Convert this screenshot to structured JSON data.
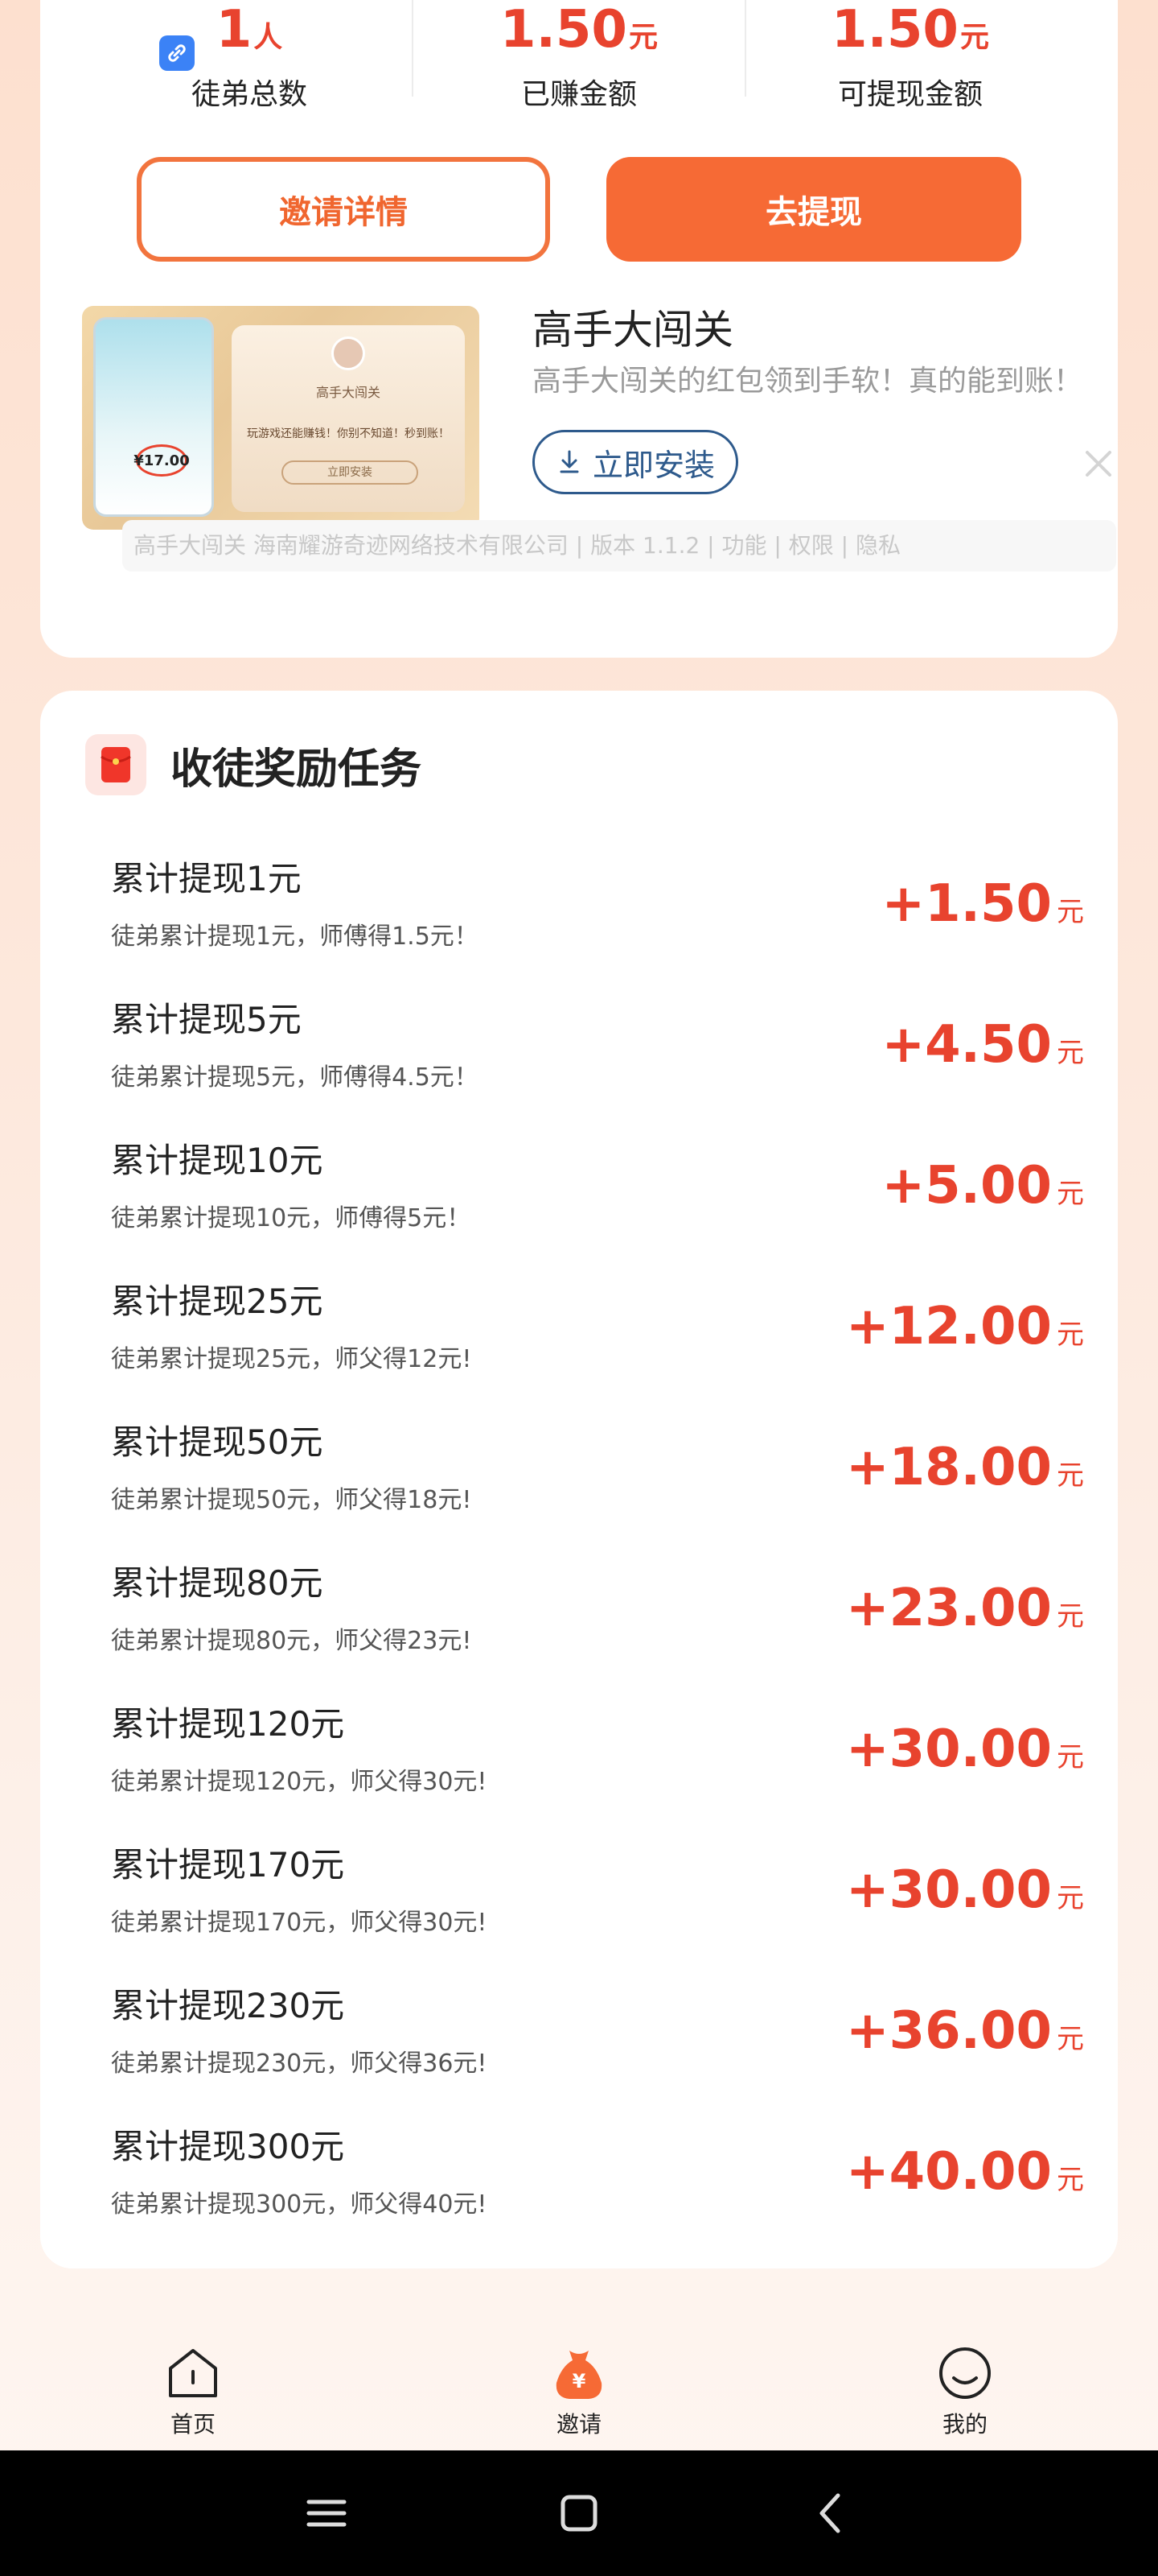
{
  "stats": [
    {
      "value": "1",
      "unit": "人",
      "label": "徒弟总数"
    },
    {
      "value": "1.50",
      "unit": "元",
      "label": "已赚金额"
    },
    {
      "value": "1.50",
      "unit": "元",
      "label": "可提现金额"
    }
  ],
  "buttons": {
    "invite_details": "邀请详情",
    "withdraw": "去提现"
  },
  "ad": {
    "image_title": "高手大闯关",
    "image_text1": "玩游戏还能赚钱！你别不知道！秒到账！",
    "image_amount": "¥17.00",
    "image_button": "立即安装",
    "title": "高手大闯关",
    "description": "高手大闯关的红包领到手软！真的能到账！",
    "install_label": "立即安装",
    "meta": "高手大闯关 海南耀游奇迹网络技术有限公司 | 版本 1.1.2 | 功能 | 权限 | 隐私"
  },
  "tasks_section": {
    "title": "收徒奖励任务",
    "items": [
      {
        "name": "累计提现1元",
        "desc": "徒弟累计提现1元，师傅得1.5元！",
        "reward": "+1.50",
        "unit": "元"
      },
      {
        "name": "累计提现5元",
        "desc": "徒弟累计提现5元，师傅得4.5元！",
        "reward": "+4.50",
        "unit": "元"
      },
      {
        "name": "累计提现10元",
        "desc": "徒弟累计提现10元，师傅得5元！",
        "reward": "+5.00",
        "unit": "元"
      },
      {
        "name": "累计提现25元",
        "desc": "徒弟累计提现25元，师父得12元!",
        "reward": "+12.00",
        "unit": "元"
      },
      {
        "name": "累计提现50元",
        "desc": "徒弟累计提现50元，师父得18元!",
        "reward": "+18.00",
        "unit": "元"
      },
      {
        "name": "累计提现80元",
        "desc": "徒弟累计提现80元，师父得23元!",
        "reward": "+23.00",
        "unit": "元"
      },
      {
        "name": "累计提现120元",
        "desc": "徒弟累计提现120元，师父得30元!",
        "reward": "+30.00",
        "unit": "元"
      },
      {
        "name": "累计提现170元",
        "desc": "徒弟累计提现170元，师父得30元!",
        "reward": "+30.00",
        "unit": "元"
      },
      {
        "name": "累计提现230元",
        "desc": "徒弟累计提现230元，师父得36元!",
        "reward": "+36.00",
        "unit": "元"
      },
      {
        "name": "累计提现300元",
        "desc": "徒弟累计提现300元，师父得40元!",
        "reward": "+40.00",
        "unit": "元"
      }
    ]
  },
  "tabbar": {
    "home": "首页",
    "invite": "邀请",
    "mine": "我的",
    "active": "invite"
  },
  "colors": {
    "accent": "#f66a35",
    "reward": "#e8432e",
    "link": "#2e5a8c"
  }
}
